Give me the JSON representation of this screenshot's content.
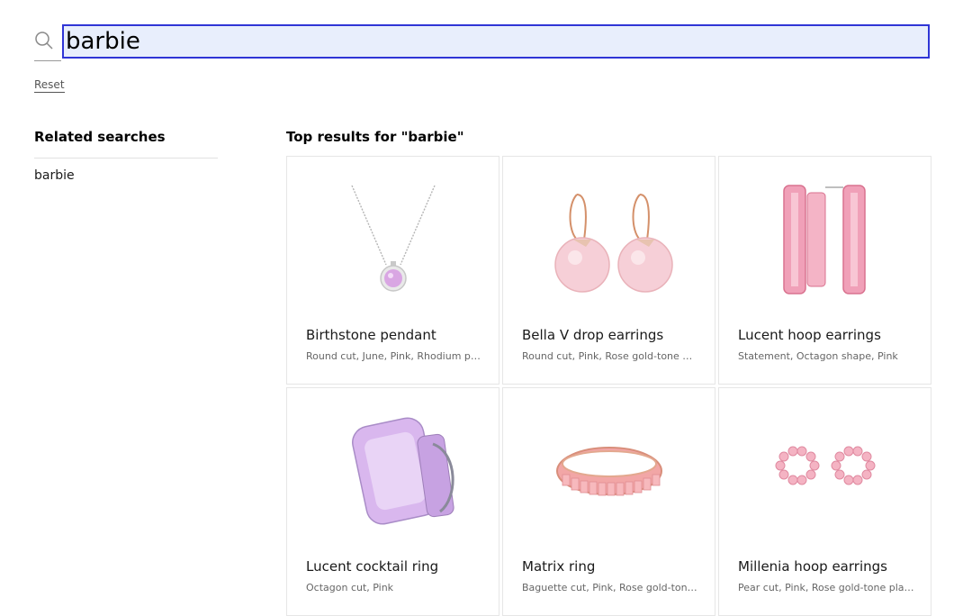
{
  "search": {
    "value": "barbie",
    "search_icon": "search-icon",
    "reset_label": "Reset"
  },
  "sidebar": {
    "title": "Related searches",
    "items": [
      {
        "label": "barbie"
      }
    ]
  },
  "results": {
    "title": "Top results for \"barbie\"",
    "products": [
      {
        "name": "Birthstone pendant",
        "description": "Round cut, June, Pink, Rhodium plated",
        "image": "pendant-necklace-image"
      },
      {
        "name": "Bella V drop earrings",
        "description": "Round cut, Pink, Rose gold-tone plated",
        "image": "drop-earrings-image"
      },
      {
        "name": "Lucent hoop earrings",
        "description": "Statement, Octagon shape, Pink",
        "image": "hoop-earrings-image"
      },
      {
        "name": "Lucent cocktail ring",
        "description": "Octagon cut, Pink",
        "image": "cocktail-ring-image"
      },
      {
        "name": "Matrix ring",
        "description": "Baguette cut, Pink, Rose gold-tone plated",
        "image": "eternity-ring-image"
      },
      {
        "name": "Millenia hoop earrings",
        "description": "Pear cut, Pink, Rose gold-tone plated",
        "image": "pear-hoop-earrings-image"
      }
    ]
  },
  "colors": {
    "focus_border": "#2f35d6",
    "input_bg": "#e8eefc",
    "accent_pink": "#f2a7c0"
  }
}
